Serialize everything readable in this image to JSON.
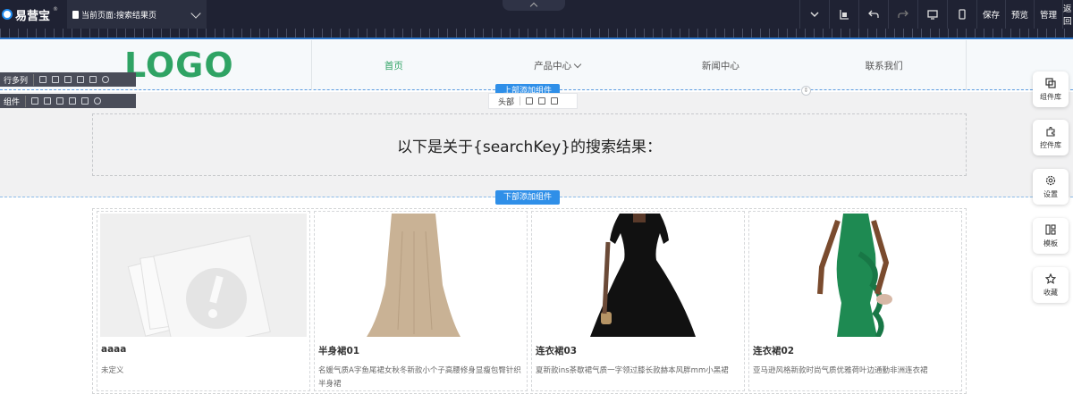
{
  "topbar": {
    "brand": "易营宝",
    "brand_mark": "®",
    "current_page": "当前页面:搜索结果页",
    "actions": {
      "save": "保存",
      "preview": "预览",
      "manage": "管理",
      "back": "返回"
    }
  },
  "header": {
    "logo": "LOGO",
    "nav": [
      {
        "label": "首页",
        "active": true
      },
      {
        "label": "产品中心",
        "has_dropdown": true
      },
      {
        "label": "新闻中心"
      },
      {
        "label": "联系我们"
      }
    ]
  },
  "editor": {
    "row_label": "行多列",
    "component_label": "组件",
    "add_above": "上部添加组件",
    "add_below": "下部添加组件",
    "section_name": "头部"
  },
  "search": {
    "title": "以下是关于{searchKey}的搜索结果："
  },
  "products": [
    {
      "name": "aaaa",
      "desc": "未定义",
      "image": "placeholder-image"
    },
    {
      "name": "半身裙01",
      "desc": "名媛气质A字鱼尾裙女秋冬新款小个子高腰修身显瘦包臀针织半身裙",
      "image": "beige-knit-skirt"
    },
    {
      "name": "连衣裙03",
      "desc": "夏新款ins茶歇裙气质一字领过膝长款赫本风胖mm小黑裙",
      "image": "black-dress"
    },
    {
      "name": "连衣裙02",
      "desc": "亚马逊风格新款时尚气质优雅荷叶边通勤非洲连衣裙",
      "image": "green-ruffle-dress"
    }
  ],
  "side_panel": [
    {
      "label": "组件库",
      "icon": "component-library-icon"
    },
    {
      "label": "控件库",
      "icon": "widget-library-icon"
    },
    {
      "label": "设置",
      "icon": "settings-icon"
    },
    {
      "label": "模板",
      "icon": "template-icon"
    },
    {
      "label": "收藏",
      "icon": "star-icon"
    }
  ],
  "colors": {
    "topbar_bg": "#1f2233",
    "accent_green": "#2fa364",
    "accent_blue": "#2f8fe8"
  }
}
